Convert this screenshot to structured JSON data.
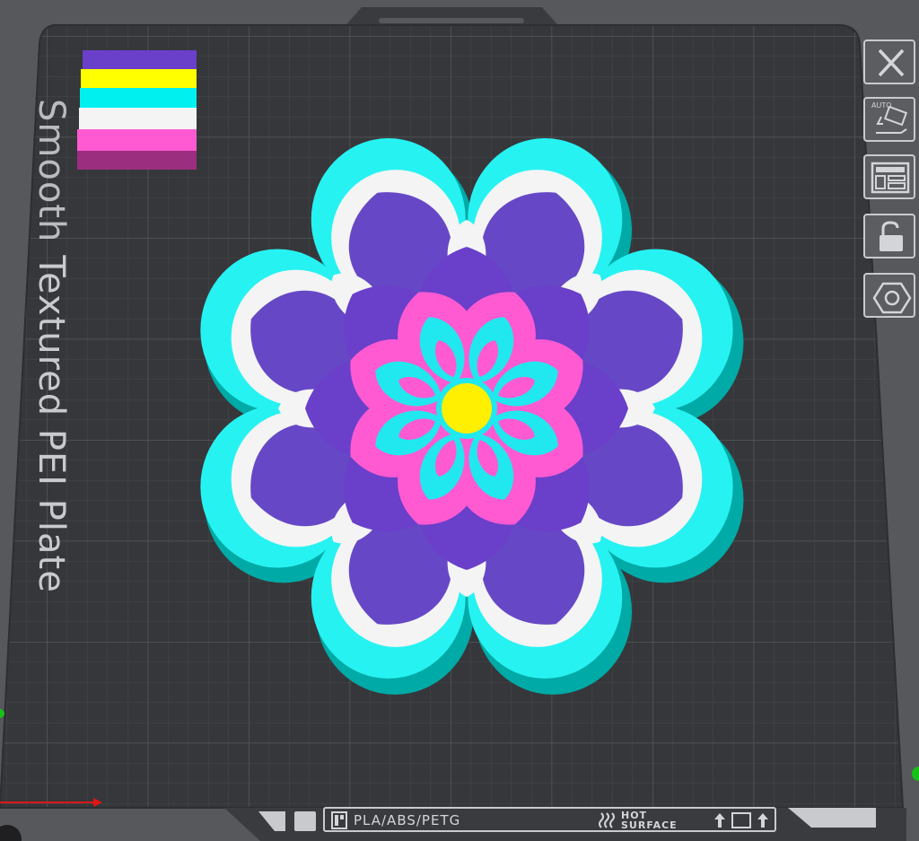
{
  "plate": {
    "label_hidden": "Smooth",
    "label": "Textured PEI Plate"
  },
  "toolbar": {
    "auto_label": "AUTO",
    "buttons": [
      "close",
      "auto-arrange",
      "layout",
      "lock",
      "nut"
    ]
  },
  "info_bar": {
    "filament": "PLA/ABS/PETG",
    "hot_line1": "HOT",
    "hot_line2": "SURFACE"
  },
  "swatch": {
    "colors": [
      "#6a3fc9",
      "#ffff00",
      "#00f0f0",
      "#f4f4f4",
      "#ff5ad2",
      "#9b2e7e"
    ]
  },
  "model": {
    "colors": {
      "outline": "#27f2f2",
      "outline_side": "#00aaa6",
      "outer_petals": "#6648c6",
      "white_layer": "#f4f4f4",
      "inner_purple": "#6a3fc9",
      "pink": "#ff5ad2",
      "cyan_petals": "#20e8ee",
      "center": "#ffef00"
    }
  }
}
